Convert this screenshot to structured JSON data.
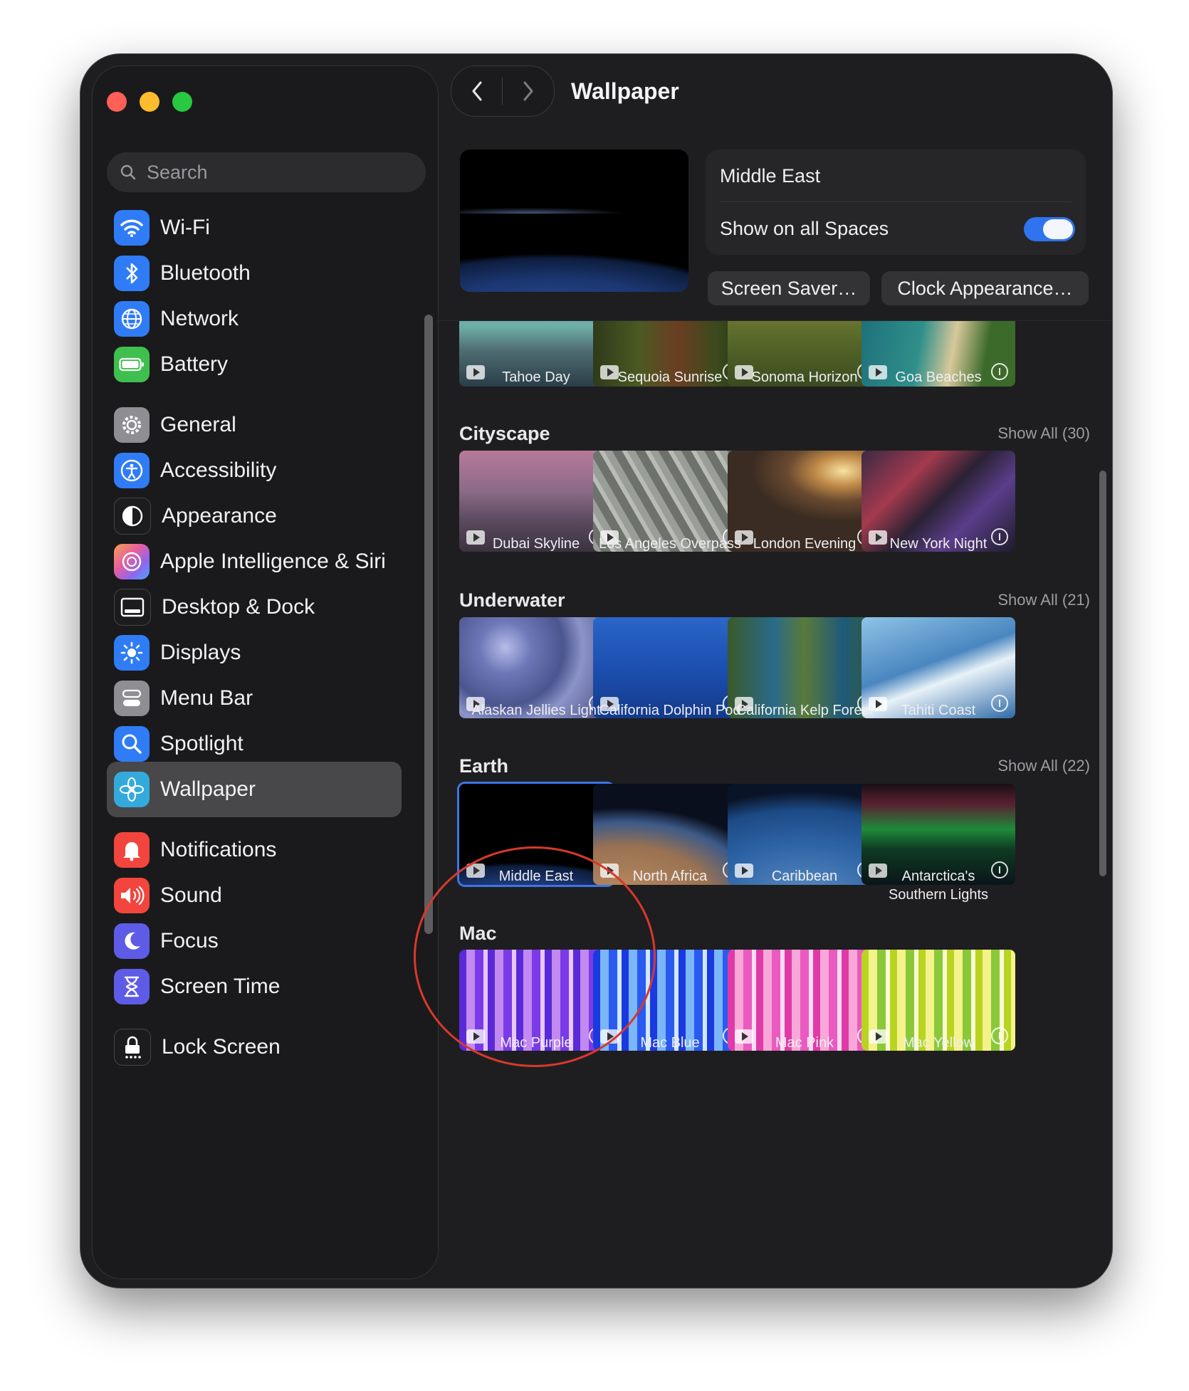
{
  "window": {
    "title": "Wallpaper"
  },
  "sidebar": {
    "search_placeholder": "Search",
    "items": [
      {
        "label": "Wi-Fi",
        "icon": "wifi-icon"
      },
      {
        "label": "Bluetooth",
        "icon": "bluetooth-icon"
      },
      {
        "label": "Network",
        "icon": "network-globe-icon"
      },
      {
        "label": "Battery",
        "icon": "battery-icon"
      },
      {
        "label": "General",
        "icon": "gear-icon"
      },
      {
        "label": "Accessibility",
        "icon": "accessibility-icon"
      },
      {
        "label": "Appearance",
        "icon": "appearance-icon"
      },
      {
        "label": "Apple Intelligence & Siri",
        "icon": "siri-icon"
      },
      {
        "label": "Desktop & Dock",
        "icon": "dock-icon"
      },
      {
        "label": "Displays",
        "icon": "brightness-icon"
      },
      {
        "label": "Menu Bar",
        "icon": "menu-bar-icon"
      },
      {
        "label": "Spotlight",
        "icon": "magnifier-icon"
      },
      {
        "label": "Wallpaper",
        "icon": "wallpaper-flower-icon",
        "selected": true
      },
      {
        "label": "Notifications",
        "icon": "bell-icon"
      },
      {
        "label": "Sound",
        "icon": "speaker-icon"
      },
      {
        "label": "Focus",
        "icon": "moon-icon"
      },
      {
        "label": "Screen Time",
        "icon": "hourglass-icon"
      },
      {
        "label": "Lock Screen",
        "icon": "lock-icon"
      }
    ]
  },
  "current": {
    "name": "Middle East",
    "show_all_spaces_label": "Show on all Spaces",
    "show_all_spaces": true,
    "screen_saver_button": "Screen Saver…",
    "clock_button": "Clock Appearance…"
  },
  "top_row": {
    "items": [
      {
        "label": "Tahoe Day"
      },
      {
        "label": "Sequoia Sunrise"
      },
      {
        "label": "Sonoma Horizon"
      },
      {
        "label": "Goa Beaches"
      }
    ]
  },
  "sections": [
    {
      "title": "Cityscape",
      "show_all": "Show All (30)",
      "items": [
        {
          "label": "Dubai Skyline"
        },
        {
          "label": "Los Angeles Overpass"
        },
        {
          "label": "London Evening"
        },
        {
          "label": "New York Night"
        }
      ]
    },
    {
      "title": "Underwater",
      "show_all": "Show All (21)",
      "items": [
        {
          "label": "Alaskan Jellies Light"
        },
        {
          "label": "California Dolphin Pod"
        },
        {
          "label": "California Kelp Forest"
        },
        {
          "label": "Tahiti Coast"
        }
      ]
    },
    {
      "title": "Earth",
      "show_all": "Show All (22)",
      "items": [
        {
          "label": "Middle East",
          "selected": true
        },
        {
          "label": "North Africa"
        },
        {
          "label": "Caribbean"
        },
        {
          "label": "Antarctica's\nSouthern Lights"
        }
      ]
    },
    {
      "title": "Mac",
      "show_all": "",
      "items": [
        {
          "label": "Mac Purple"
        },
        {
          "label": "Mac Blue"
        },
        {
          "label": "Mac Pink"
        },
        {
          "label": "Mac Yellow"
        }
      ]
    }
  ],
  "colors": {
    "accent": "#2f73ef",
    "annotation": "#d8392b"
  }
}
